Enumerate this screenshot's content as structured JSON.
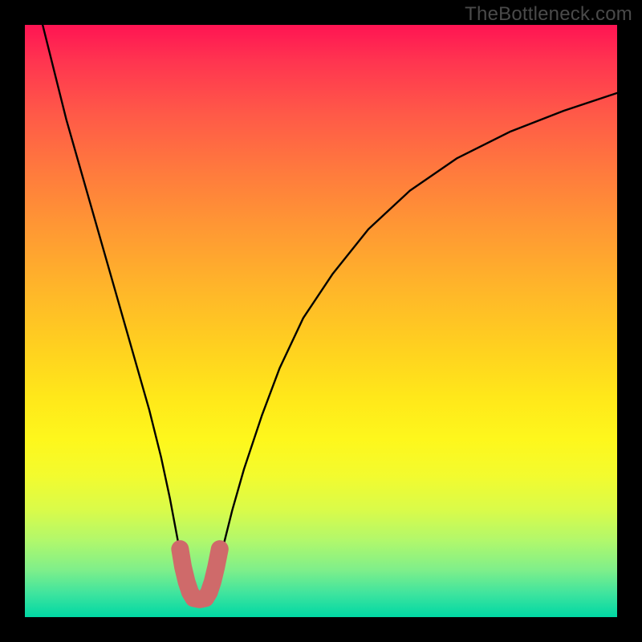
{
  "watermark": "TheBottleneck.com",
  "chart_data": {
    "type": "line",
    "title": "",
    "xlabel": "",
    "ylabel": "",
    "x_range": [
      0,
      100
    ],
    "y_range": [
      0,
      100
    ],
    "series": [
      {
        "name": "main-curve",
        "color": "#000000",
        "x": [
          3,
          5,
          7,
          9,
          11,
          13,
          15,
          17,
          19,
          21,
          23,
          24.5,
          26,
          27,
          27.8,
          28.5,
          30.5,
          31.4,
          32.3,
          33.5,
          35,
          37,
          40,
          43,
          47,
          52,
          58,
          65,
          73,
          82,
          91,
          100
        ],
        "y": [
          100,
          92,
          84,
          77,
          70,
          63,
          56,
          49,
          42,
          35,
          27,
          20,
          12,
          7,
          4,
          2.5,
          2.5,
          4,
          7,
          12,
          18,
          25,
          34,
          42,
          50.5,
          58,
          65.5,
          72,
          77.5,
          82,
          85.5,
          88.5
        ]
      },
      {
        "name": "highlight-segment",
        "color": "#cf6a6a",
        "x": [
          26.2,
          26.7,
          27.3,
          27.9,
          28.5,
          29.5,
          30.5,
          31.1,
          31.7,
          32.3,
          32.9
        ],
        "y": [
          11.5,
          8.5,
          6.0,
          4.2,
          3.2,
          3.0,
          3.2,
          4.2,
          6.0,
          8.5,
          11.5
        ]
      }
    ],
    "gradient_colors": {
      "top": "#ff1453",
      "middle": "#ffe81a",
      "bottom": "#00d8a4"
    }
  }
}
